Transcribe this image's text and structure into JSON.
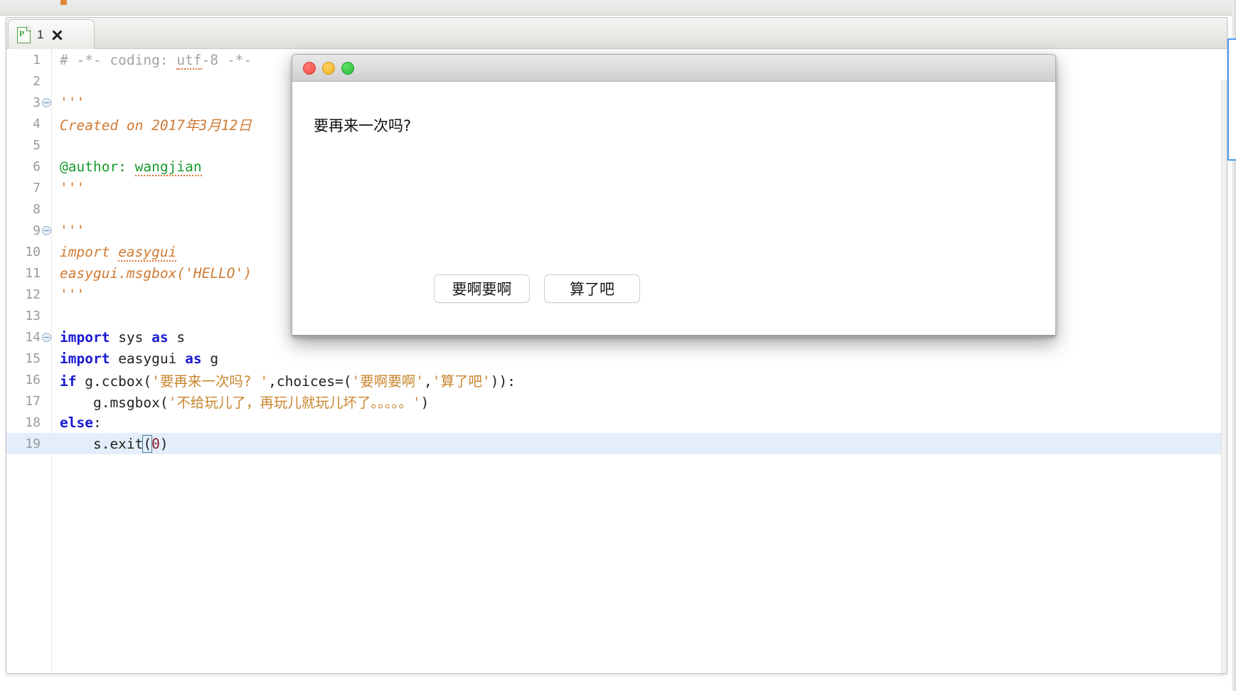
{
  "window": {
    "tab": {
      "icon": "python-file-icon",
      "label": "1",
      "close_icon": "close-icon"
    }
  },
  "editor": {
    "language": "python",
    "current_line": 19,
    "colors": {
      "keyword": "#1919d0",
      "string": "#c8862f",
      "comment": "#a3a3a3",
      "docstring": "#d07b34",
      "number": "#8b1b2b",
      "current_line_bg": "#e4eefb",
      "spell_underline": "#e0712f"
    },
    "lines": [
      {
        "n": "1",
        "fold": false,
        "text": "# -*- coding: utf-8 -*-"
      },
      {
        "n": "2",
        "fold": false,
        "text": ""
      },
      {
        "n": "3",
        "fold": true,
        "text": "'''"
      },
      {
        "n": "4",
        "fold": false,
        "text": "Created on 2017年3月12日"
      },
      {
        "n": "5",
        "fold": false,
        "text": ""
      },
      {
        "n": "6",
        "fold": false,
        "text": "@author: wangjian"
      },
      {
        "n": "7",
        "fold": false,
        "text": "'''"
      },
      {
        "n": "8",
        "fold": false,
        "text": ""
      },
      {
        "n": "9",
        "fold": true,
        "text": "'''"
      },
      {
        "n": "10",
        "fold": false,
        "text": "import easygui"
      },
      {
        "n": "11",
        "fold": false,
        "text": "easygui.msgbox('HELLO')"
      },
      {
        "n": "12",
        "fold": false,
        "text": "'''"
      },
      {
        "n": "13",
        "fold": false,
        "text": ""
      },
      {
        "n": "14",
        "fold": true,
        "text": "import sys as s"
      },
      {
        "n": "15",
        "fold": false,
        "text": "import easygui as g"
      },
      {
        "n": "16",
        "fold": false,
        "text": "if g.ccbox('要再来一次吗? ',choices=('要啊要啊','算了吧')):"
      },
      {
        "n": "17",
        "fold": false,
        "text": "    g.msgbox('不给玩儿了，再玩儿就玩儿坏了。。。。。')"
      },
      {
        "n": "18",
        "fold": false,
        "text": "else:"
      },
      {
        "n": "19",
        "fold": false,
        "text": "    s.exit(0)"
      }
    ],
    "tokens": {
      "l1_comment": "# -*- coding: ",
      "l1_spell": "utf",
      "l1_comment_tail": "-8 -*-",
      "l3_quote": "'''",
      "l4_doc": "Created on 2017年3月12日",
      "l6_author": "@author: ",
      "l6_name": "wangjian",
      "l7_quote": "'''",
      "l9_quote": "'''",
      "l10_doc": "import ",
      "l10_mod": "easygui",
      "l11_doc": "easygui.msgbox('HELLO')",
      "l12_quote": "'''",
      "l14_import": "import",
      "l14_mid": " sys ",
      "l14_as": "as",
      "l14_tail": " s",
      "l15_import": "import",
      "l15_mid": " easygui ",
      "l15_as": "as",
      "l15_tail": " g",
      "l16_if": "if",
      "l16_call": " g.ccbox(",
      "l16_str1": "'要再来一次吗? '",
      "l16_comma": ",choices=(",
      "l16_str2": "'要啊要啊'",
      "l16_comma2": ",",
      "l16_str3": "'算了吧'",
      "l16_tail": ")):",
      "l17_call": "    g.msgbox(",
      "l17_str": "'不给玩儿了，再玩儿就玩儿坏了。。。。。'",
      "l17_tail": ")",
      "l18_else": "else",
      "l18_colon": ":",
      "l19_pre": "    s.exit",
      "l19_paren_open": "(",
      "l19_num": "0",
      "l19_paren_close": ")"
    }
  },
  "dialog": {
    "type": "easygui-ccbox",
    "traffic_lights": [
      "close-light",
      "minimize-light",
      "zoom-light"
    ],
    "message": "要再来一次吗?",
    "buttons": [
      {
        "label": "要啊要啊",
        "name": "confirm-button"
      },
      {
        "label": "算了吧",
        "name": "cancel-button"
      }
    ]
  }
}
